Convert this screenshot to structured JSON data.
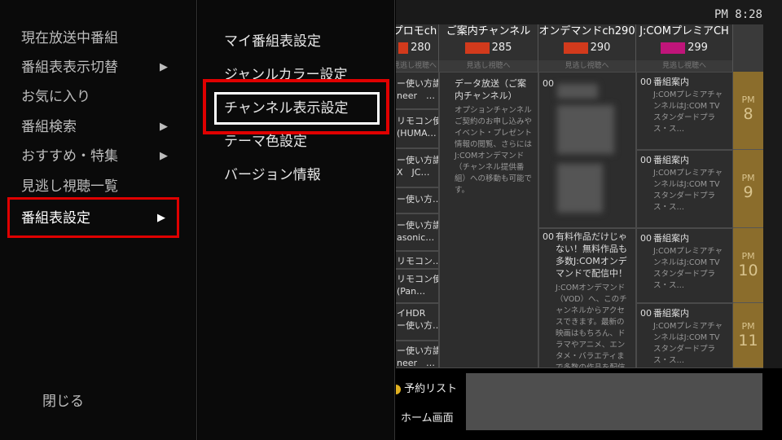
{
  "left_menu": {
    "items": [
      {
        "label": "現在放送中番組",
        "arrow": ""
      },
      {
        "label": "番組表表示切替",
        "arrow": "▶"
      },
      {
        "label": "お気に入り",
        "arrow": ""
      },
      {
        "label": "番組検索",
        "arrow": "▶"
      },
      {
        "label": "おすすめ・特集",
        "arrow": "▶"
      },
      {
        "label": "見逃し視聴一覧",
        "arrow": ""
      },
      {
        "label": "番組表設定",
        "arrow": "▶"
      }
    ],
    "close_label": "閉じる"
  },
  "sub_menu": {
    "items": [
      {
        "label": "マイ番組表設定"
      },
      {
        "label": "ジャンルカラー設定"
      },
      {
        "label": "チャンネル表示設定"
      },
      {
        "label": "テーマ色設定"
      },
      {
        "label": "バージョン情報"
      }
    ]
  },
  "epg": {
    "clock": "PM 8:28",
    "channels": [
      {
        "name": "プロモch",
        "number": "280"
      },
      {
        "name": "ご案内チャンネル",
        "number": "285"
      },
      {
        "name": "オンデマンドch290",
        "number": "290"
      },
      {
        "name": "J:COMプレミアCH",
        "number": "299"
      }
    ],
    "strip_label": "見逃し視聴へ",
    "col1_cells": [
      "ー使い方講\nneer　…",
      "リモコン使\n(HUMA…",
      "ー使い方講\nX　JC…",
      "ー使い方…",
      "ー使い方講\nasonic…",
      "リモコン…",
      "リモコン使\n(Pan…",
      "イHDR\nー使い方…",
      "ー使い方講\nneer　…"
    ],
    "col2": {
      "min": "",
      "title": "データ放送（ご案内チャンネル）",
      "desc": "オプションチャンネルご契約のお申し込みやイベント・プレゼント情報の閲覧、さらにはJ:COMオンデマンド（チャンネル提供番組）への移動も可能です。"
    },
    "col3_top_min": "00",
    "col3_bottom": {
      "min": "00",
      "title": "有料作品だけじゃない！無料作品も多数J:COMオンデマンドで配信中！",
      "desc": "J:COMオンデマンド（VOD）へ、このチャンネルからアクセスできます。最新の映画はもちろん、ドラマやアニメ、エンタメ・バラエティまで多数の作品を配信中。"
    },
    "col4_cells": [
      {
        "min": "00",
        "title": "番組案内",
        "desc": "J:COMプレミアチャンネルはJ:COM TV スタンダードプラス・ス…"
      },
      {
        "min": "00",
        "title": "番組案内",
        "desc": "J:COMプレミアチャンネルはJ:COM TV スタンダードプラス・ス…"
      },
      {
        "min": "00",
        "title": "番組案内",
        "desc": "J:COMプレミアチャンネルはJ:COM TV スタンダードプラス・ス…"
      },
      {
        "min": "00",
        "title": "番組案内",
        "desc": "J:COMプレミアチャンネルはJ:COM TV スタンダードプラス・ス…"
      }
    ],
    "times": [
      {
        "ampm": "PM",
        "hour": "8"
      },
      {
        "ampm": "PM",
        "hour": "9"
      },
      {
        "ampm": "PM",
        "hour": "10"
      },
      {
        "ampm": "PM",
        "hour": "11"
      }
    ],
    "bottom": {
      "reserve_label": "予約リスト",
      "home_label": "ホーム画面"
    }
  }
}
